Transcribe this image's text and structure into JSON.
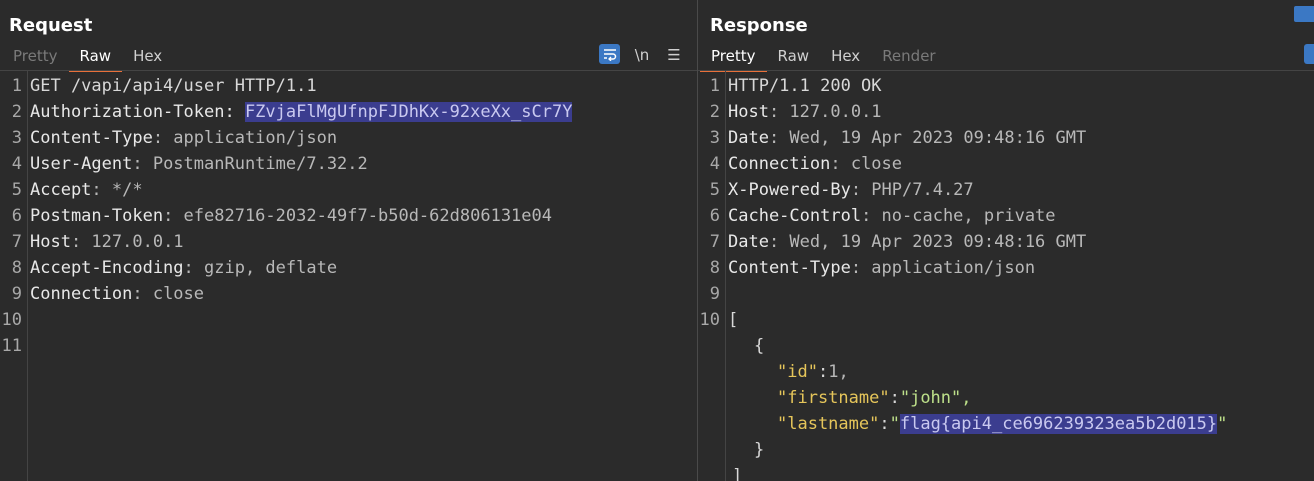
{
  "request": {
    "title": "Request",
    "tabs": [
      {
        "label": "Pretty"
      },
      {
        "label": "Raw"
      },
      {
        "label": "Hex"
      }
    ],
    "tools": {
      "newline_label": "\\n",
      "menu_label": "☰"
    },
    "lines": [
      {
        "n": "1",
        "key": "GET /vapi/api4/user HTTP/1.1",
        "val": ""
      },
      {
        "n": "2",
        "key": "Authorization-Token: ",
        "val": "FZvjaFlMgUfnpFJDhKx-92xeXx_sCr7Y"
      },
      {
        "n": "3",
        "key": "Content-Type",
        "val": ": application/json"
      },
      {
        "n": "4",
        "key": "User-Agent",
        "val": ": PostmanRuntime/7.32.2"
      },
      {
        "n": "5",
        "key": "Accept",
        "val": ": */*"
      },
      {
        "n": "6",
        "key": "Postman-Token",
        "val": ": efe82716-2032-49f7-b50d-62d806131e04"
      },
      {
        "n": "7",
        "key": "Host",
        "val": ": 127.0.0.1"
      },
      {
        "n": "8",
        "key": "Accept-Encoding",
        "val": ": gzip, deflate"
      },
      {
        "n": "9",
        "key": "Connection",
        "val": ": close"
      },
      {
        "n": "10",
        "key": "",
        "val": ""
      },
      {
        "n": "11",
        "key": "",
        "val": ""
      }
    ]
  },
  "response": {
    "title": "Response",
    "tabs": [
      {
        "label": "Pretty"
      },
      {
        "label": "Raw"
      },
      {
        "label": "Hex"
      },
      {
        "label": "Render"
      }
    ],
    "lines": [
      {
        "n": "1",
        "key": "HTTP/1.1 200 OK",
        "val": ""
      },
      {
        "n": "2",
        "key": "Host",
        "val": ": 127.0.0.1"
      },
      {
        "n": "3",
        "key": "Date",
        "val": ": Wed, 19 Apr 2023 09:48:16 GMT"
      },
      {
        "n": "4",
        "key": "Connection",
        "val": ": close"
      },
      {
        "n": "5",
        "key": "X-Powered-By",
        "val": ": PHP/7.4.27"
      },
      {
        "n": "6",
        "key": "Cache-Control",
        "val": ": no-cache, private"
      },
      {
        "n": "7",
        "key": "Date",
        "val": ": Wed, 19 Apr 2023 09:48:16 GMT"
      },
      {
        "n": "8",
        "key": "Content-Type",
        "val": ": application/json"
      },
      {
        "n": "9",
        "key": "",
        "val": ""
      },
      {
        "n": "10",
        "key": "[",
        "val": ""
      }
    ],
    "json": {
      "open_brace": "{",
      "id_key": "\"id\"",
      "id_val": "1,",
      "firstname_key": "\"firstname\"",
      "firstname_val": "\"john\",",
      "lastname_key": "\"lastname\"",
      "lastname_quote_open": "\"",
      "lastname_val": "flag{api4_ce696239323ea5b2d015}",
      "lastname_quote_close": "\"",
      "close_brace": "}",
      "close_bracket": "]",
      "colon": ":"
    }
  },
  "colors": {
    "accent": "#e8703a",
    "selection": "#3b3d8f",
    "button": "#3b78c4",
    "json_key": "#e5c55a",
    "json_string": "#bde08a"
  }
}
